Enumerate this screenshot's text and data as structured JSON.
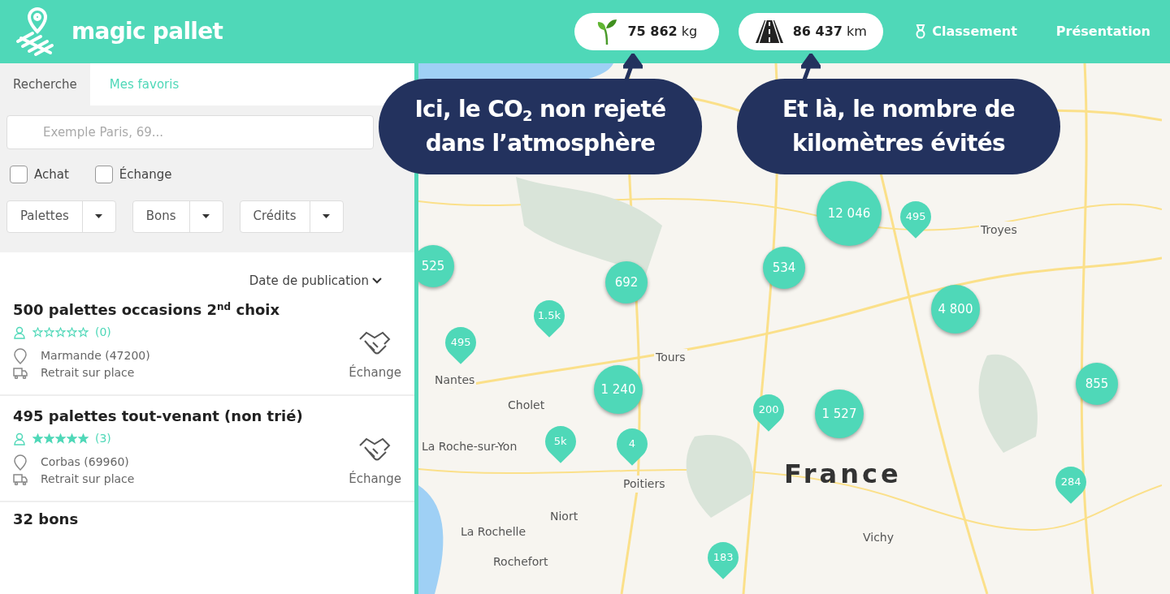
{
  "header": {
    "brand": "magic pallet",
    "stats": [
      {
        "kind": "co2",
        "value": "75 862",
        "unit": "kg"
      },
      {
        "kind": "road",
        "value": "86 437",
        "unit": "km"
      }
    ],
    "nav": [
      {
        "label": "Classement"
      },
      {
        "label": "Présentation"
      }
    ]
  },
  "sidebar": {
    "tabs": [
      {
        "label": "Recherche",
        "selected": true
      },
      {
        "label": "Mes favoris",
        "selected": false
      }
    ],
    "search": {
      "placeholder": "Exemple Paris, 69..."
    },
    "checkboxes": [
      {
        "label": "Achat",
        "checked": false
      },
      {
        "label": "Échange",
        "checked": false
      }
    ],
    "dropdowns": [
      "Palettes",
      "Bons",
      "Crédits"
    ],
    "sort": "Date de publication",
    "listings": [
      {
        "title": "500 palettes occasions 2$^{nd}$ choix",
        "stars": 0,
        "rating": "(0)",
        "location": "Marmande (47200)",
        "delivery": "Retrait sur place",
        "type": "Échange"
      },
      {
        "title": "495 palettes tout-venant (non trié)",
        "stars": 5,
        "rating": "(3)",
        "location": "Corbas (69960)",
        "delivery": "Retrait sur place",
        "type": "Échange"
      },
      {
        "title": "32 bons"
      }
    ]
  },
  "map": {
    "labels": [
      {
        "text": "Troyes",
        "kind": "city"
      },
      {
        "text": "Tours",
        "kind": "city"
      },
      {
        "text": "Nantes",
        "kind": "city"
      },
      {
        "text": "Cholet",
        "kind": "city"
      },
      {
        "text": "La Roche-sur-Yon",
        "kind": "city"
      },
      {
        "text": "Poitiers",
        "kind": "city"
      },
      {
        "text": "France",
        "kind": "country"
      },
      {
        "text": "Niort",
        "kind": "city"
      },
      {
        "text": "La Rochelle",
        "kind": "city"
      },
      {
        "text": "Vichy",
        "kind": "city"
      },
      {
        "text": "Rochefort",
        "kind": "city"
      }
    ],
    "markers": [
      {
        "text": "525",
        "kind": "cluster"
      },
      {
        "text": "692",
        "kind": "cluster"
      },
      {
        "text": "534",
        "kind": "cluster"
      },
      {
        "text": "12 046",
        "kind": "cluster"
      },
      {
        "text": "4 800",
        "kind": "cluster"
      },
      {
        "text": "1 240",
        "kind": "cluster"
      },
      {
        "text": "1 527",
        "kind": "cluster"
      },
      {
        "text": "855",
        "kind": "cluster"
      },
      {
        "text": "495",
        "kind": "pin"
      },
      {
        "text": "1.5k",
        "kind": "pin"
      },
      {
        "text": "495",
        "kind": "pin"
      },
      {
        "text": "5k",
        "kind": "pin"
      },
      {
        "text": "4",
        "kind": "pin"
      },
      {
        "text": "200",
        "kind": "pin"
      },
      {
        "text": "284",
        "kind": "pin"
      },
      {
        "text": "183",
        "kind": "pin"
      }
    ]
  },
  "callouts": [
    "Ici, le CO$_{2}$ non rejeté dans l’atmosphère",
    "Et là, le nombre de kilomètres évités"
  ]
}
